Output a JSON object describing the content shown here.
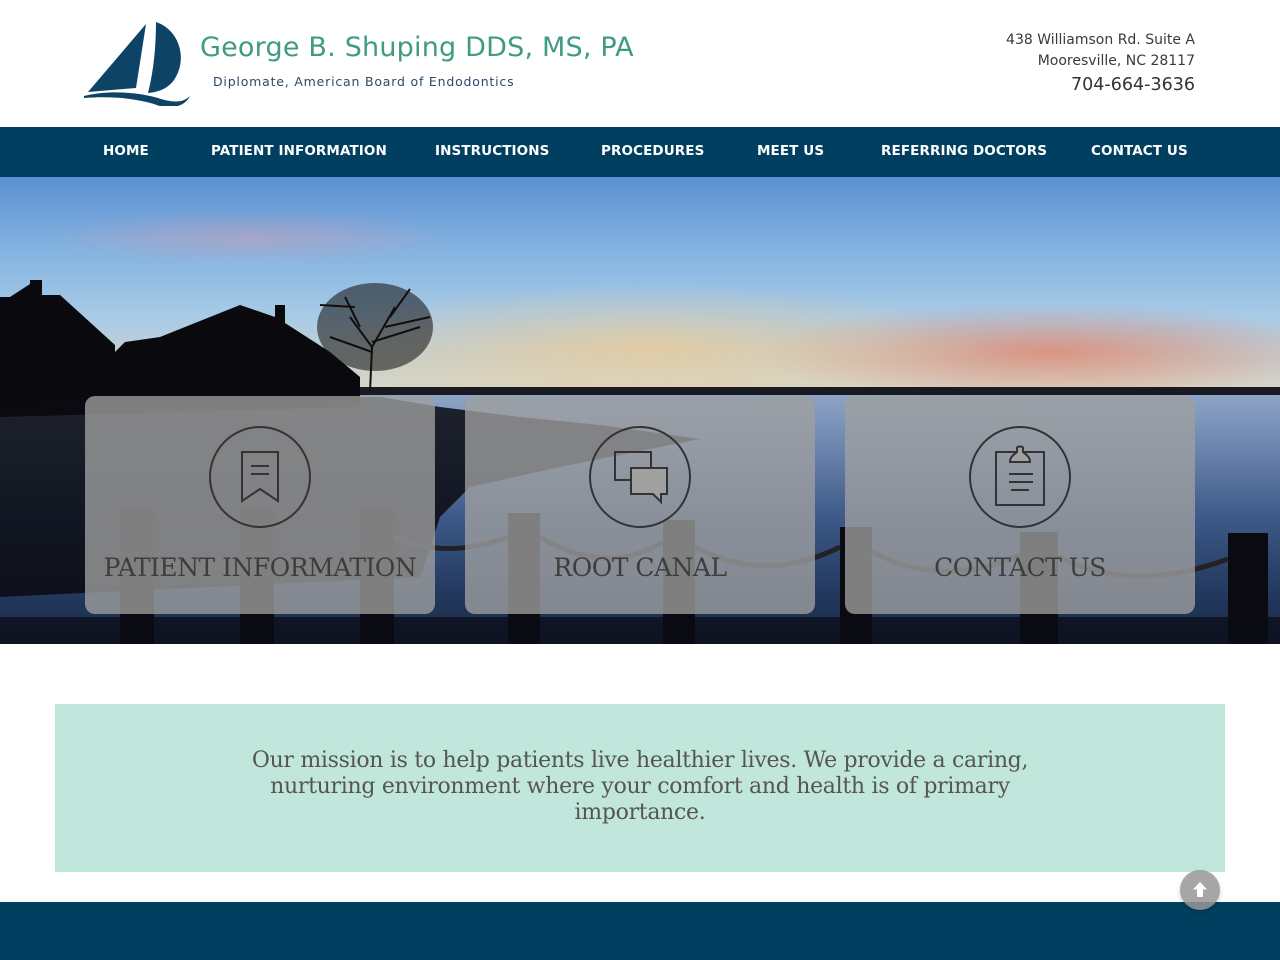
{
  "header": {
    "logo": {
      "icon": "sailboat-logo-icon",
      "title": "George B. Shuping DDS, MS, PA",
      "subtitle": "Diplomate, American Board of Endodontics",
      "brand_color": "#3f9b84",
      "mark_color": "#0d4466"
    },
    "contact": {
      "address_line1": "438 Williamson Rd. Suite A",
      "address_line2": "Mooresville, NC 28117",
      "phone": "704-664-3636"
    }
  },
  "nav": {
    "background": "#003f60",
    "items": [
      {
        "label": "HOME"
      },
      {
        "label": "PATIENT INFORMATION"
      },
      {
        "label": "INSTRUCTIONS"
      },
      {
        "label": "PROCEDURES"
      },
      {
        "label": "MEET US"
      },
      {
        "label": "REFERRING DOCTORS"
      },
      {
        "label": "CONTACT US"
      }
    ]
  },
  "hero": {
    "image": "sunset-over-lake-photo",
    "cards": [
      {
        "label": "PATIENT INFORMATION",
        "icon": "bookmark-icon"
      },
      {
        "label": "ROOT CANAL",
        "icon": "chat-bubbles-icon"
      },
      {
        "label": "CONTACT US",
        "icon": "clipboard-icon"
      }
    ]
  },
  "mission": {
    "text": "Our mission is to help patients live healthier lives. We provide a caring, nurturing environment where your comfort and health is of primary importance.",
    "background": "#c1e6db"
  },
  "scroll_top": {
    "icon": "arrow-up-icon"
  },
  "footer": {
    "background": "#003f60"
  }
}
